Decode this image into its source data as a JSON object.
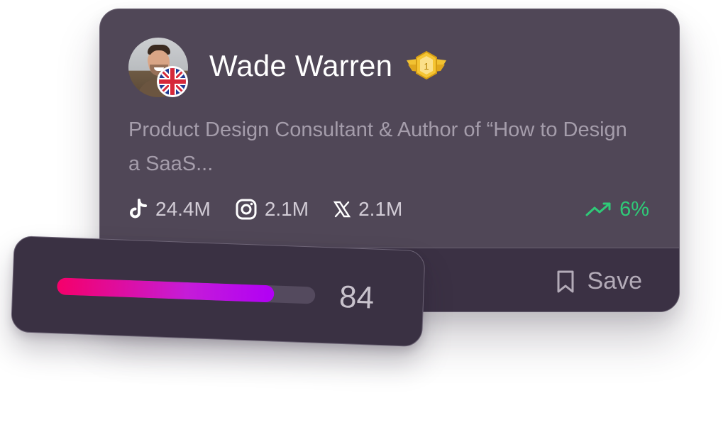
{
  "profile": {
    "name": "Wade Warren",
    "rank_badge": "1",
    "country_flag": "uk-flag-icon",
    "bio": "Product Design Consultant & Author of “How to Design a SaaS..."
  },
  "stats": [
    {
      "platform": "tiktok",
      "icon": "tiktok-icon",
      "value": "24.4M"
    },
    {
      "platform": "instagram",
      "icon": "instagram-icon",
      "value": "2.1M"
    },
    {
      "platform": "x",
      "icon": "x-icon",
      "value": "2.1M"
    }
  ],
  "trend": {
    "icon": "trending-up-icon",
    "value": "6%",
    "color": "#2fca78"
  },
  "actions": {
    "save_label": "Save"
  },
  "score": {
    "value": "84",
    "progress_fraction": 0.84
  },
  "colors": {
    "card_bg": "#504757",
    "footer_bg": "#3b3144",
    "score_card_bg": "#3a3143",
    "gradient_start": "#f5006a",
    "gradient_end": "#b100f5"
  }
}
